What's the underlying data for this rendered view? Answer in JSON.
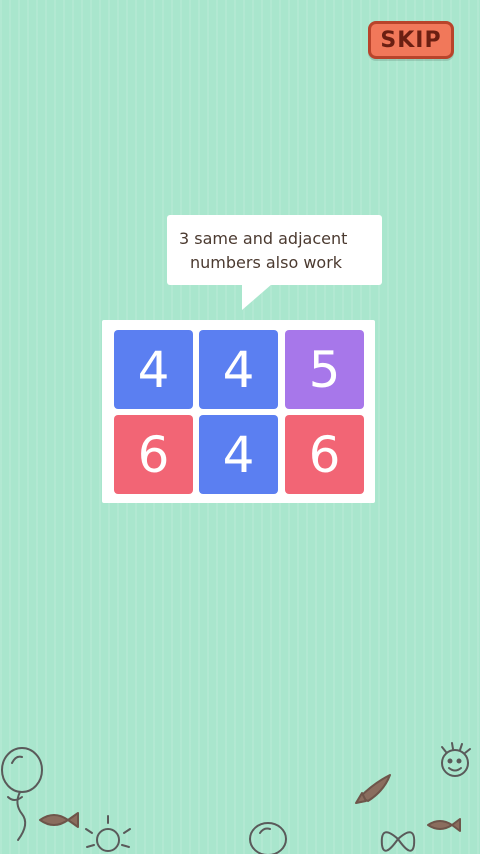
{
  "skip": {
    "label": "SKIP"
  },
  "tooltip": {
    "line1": "3 same and adjacent",
    "line2": "numbers also work"
  },
  "board": {
    "tiles": [
      {
        "value": "4",
        "color": "#5b7ff1"
      },
      {
        "value": "4",
        "color": "#5b7ff1"
      },
      {
        "value": "5",
        "color": "#a777ea"
      },
      {
        "value": "6",
        "color": "#f26575"
      },
      {
        "value": "4",
        "color": "#5b7ff1"
      },
      {
        "value": "6",
        "color": "#f26575"
      }
    ]
  },
  "colors": {
    "background": "#a9e6cd",
    "skip_fill": "#f1785a",
    "skip_border": "#b9442b",
    "tooltip_text": "#4b3a30"
  },
  "icons": {
    "balloon": "balloon-doodle-icon",
    "fish": "fish-doodle-icon",
    "sun": "sun-doodle-icon",
    "face": "face-doodle-icon",
    "bow": "bow-doodle-icon"
  }
}
